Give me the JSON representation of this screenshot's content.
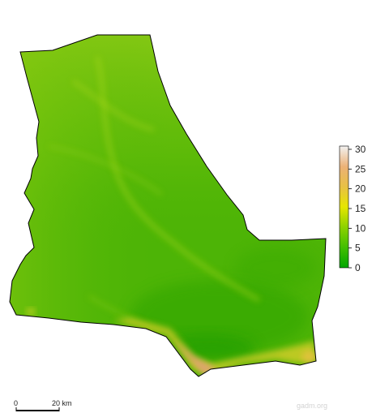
{
  "legend": {
    "ticks": [
      "0",
      "5",
      "10",
      "15",
      "20",
      "25",
      "30"
    ],
    "colors": [
      "#00a600",
      "#3fbe00",
      "#8bd100",
      "#e6e600",
      "#e8c142",
      "#ecb176",
      "#f2f2f2"
    ]
  },
  "scale_bar": {
    "start_label": "0",
    "end_label": "20 km"
  },
  "credit": "gadm.org"
}
